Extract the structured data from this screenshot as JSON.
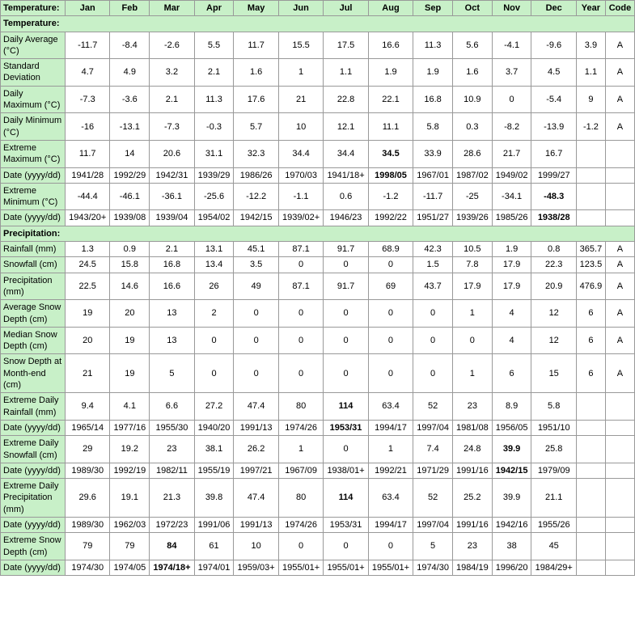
{
  "headers": {
    "label": "Temperature:",
    "cols": [
      "Jan",
      "Feb",
      "Mar",
      "Apr",
      "May",
      "Jun",
      "Jul",
      "Aug",
      "Sep",
      "Oct",
      "Nov",
      "Dec",
      "Year",
      "Code"
    ]
  },
  "sections": [
    {
      "type": "section-header",
      "label": "Temperature:"
    },
    {
      "type": "data-row",
      "label": "Daily Average (°C)",
      "values": [
        "-11.7",
        "-8.4",
        "-2.6",
        "5.5",
        "11.7",
        "15.5",
        "17.5",
        "16.6",
        "11.3",
        "5.6",
        "-4.1",
        "-9.6",
        "3.9",
        "A"
      ]
    },
    {
      "type": "data-row",
      "label": "Standard Deviation",
      "values": [
        "4.7",
        "4.9",
        "3.2",
        "2.1",
        "1.6",
        "1",
        "1.1",
        "1.9",
        "1.9",
        "1.6",
        "3.7",
        "4.5",
        "1.1",
        "A"
      ]
    },
    {
      "type": "data-row",
      "label": "Daily Maximum (°C)",
      "values": [
        "-7.3",
        "-3.6",
        "2.1",
        "11.3",
        "17.6",
        "21",
        "22.8",
        "22.1",
        "16.8",
        "10.9",
        "0",
        "-5.4",
        "9",
        "A"
      ]
    },
    {
      "type": "data-row",
      "label": "Daily Minimum (°C)",
      "values": [
        "-16",
        "-13.1",
        "-7.3",
        "-0.3",
        "5.7",
        "10",
        "12.1",
        "11.1",
        "5.8",
        "0.3",
        "-8.2",
        "-13.9",
        "-1.2",
        "A"
      ]
    },
    {
      "type": "data-row",
      "label": "Extreme Maximum (°C)",
      "values": [
        "11.7",
        "14",
        "20.6",
        "31.1",
        "32.3",
        "34.4",
        "34.4",
        "34.5",
        "33.9",
        "28.6",
        "21.7",
        "16.7",
        "",
        ""
      ],
      "bold_indices": [
        7
      ]
    },
    {
      "type": "data-row",
      "label": "Date (yyyy/dd)",
      "values": [
        "1941/28",
        "1992/29",
        "1942/31",
        "1939/29",
        "1986/26",
        "1970/03",
        "1941/18+",
        "1998/05",
        "1967/01",
        "1987/02",
        "1949/02",
        "1999/27",
        "",
        ""
      ],
      "bold_indices": [
        7
      ]
    },
    {
      "type": "data-row",
      "label": "Extreme Minimum (°C)",
      "values": [
        "-44.4",
        "-46.1",
        "-36.1",
        "-25.6",
        "-12.2",
        "-1.1",
        "0.6",
        "-1.2",
        "-11.7",
        "-25",
        "-34.1",
        "-48.3",
        "",
        ""
      ],
      "bold_indices": [
        11
      ]
    },
    {
      "type": "data-row",
      "label": "Date (yyyy/dd)",
      "values": [
        "1943/20+",
        "1939/08",
        "1939/04",
        "1954/02",
        "1942/15",
        "1939/02+",
        "1946/23",
        "1992/22",
        "1951/27",
        "1939/26",
        "1985/26",
        "1938/28",
        "",
        ""
      ],
      "bold_indices": [
        11
      ]
    },
    {
      "type": "section-header",
      "label": "Precipitation:"
    },
    {
      "type": "data-row",
      "label": "Rainfall (mm)",
      "values": [
        "1.3",
        "0.9",
        "2.1",
        "13.1",
        "45.1",
        "87.1",
        "91.7",
        "68.9",
        "42.3",
        "10.5",
        "1.9",
        "0.8",
        "365.7",
        "A"
      ]
    },
    {
      "type": "data-row",
      "label": "Snowfall (cm)",
      "values": [
        "24.5",
        "15.8",
        "16.8",
        "13.4",
        "3.5",
        "0",
        "0",
        "0",
        "1.5",
        "7.8",
        "17.9",
        "22.3",
        "123.5",
        "A"
      ]
    },
    {
      "type": "data-row",
      "label": "Precipitation (mm)",
      "values": [
        "22.5",
        "14.6",
        "16.6",
        "26",
        "49",
        "87.1",
        "91.7",
        "69",
        "43.7",
        "17.9",
        "17.9",
        "20.9",
        "476.9",
        "A"
      ]
    },
    {
      "type": "data-row",
      "label": "Average Snow Depth (cm)",
      "values": [
        "19",
        "20",
        "13",
        "2",
        "0",
        "0",
        "0",
        "0",
        "0",
        "1",
        "4",
        "12",
        "6",
        "A"
      ]
    },
    {
      "type": "data-row",
      "label": "Median Snow Depth (cm)",
      "values": [
        "20",
        "19",
        "13",
        "0",
        "0",
        "0",
        "0",
        "0",
        "0",
        "0",
        "4",
        "12",
        "6",
        "A"
      ]
    },
    {
      "type": "data-row",
      "label": "Snow Depth at Month-end (cm)",
      "values": [
        "21",
        "19",
        "5",
        "0",
        "0",
        "0",
        "0",
        "0",
        "0",
        "1",
        "6",
        "15",
        "6",
        "A"
      ]
    },
    {
      "type": "data-row",
      "label": "Extreme Daily Rainfall (mm)",
      "values": [
        "9.4",
        "4.1",
        "6.6",
        "27.2",
        "47.4",
        "80",
        "114",
        "63.4",
        "52",
        "23",
        "8.9",
        "5.8",
        "",
        ""
      ],
      "bold_indices": [
        6
      ]
    },
    {
      "type": "data-row",
      "label": "Date (yyyy/dd)",
      "values": [
        "1965/14",
        "1977/16",
        "1955/30",
        "1940/20",
        "1991/13",
        "1974/26",
        "1953/31",
        "1994/17",
        "1997/04",
        "1981/08",
        "1956/05",
        "1951/10",
        "",
        ""
      ],
      "bold_indices": [
        6
      ]
    },
    {
      "type": "data-row",
      "label": "Extreme Daily Snowfall (cm)",
      "values": [
        "29",
        "19.2",
        "23",
        "38.1",
        "26.2",
        "1",
        "0",
        "1",
        "7.4",
        "24.8",
        "39.9",
        "25.8",
        "",
        ""
      ],
      "bold_indices": [
        10
      ]
    },
    {
      "type": "data-row",
      "label": "Date (yyyy/dd)",
      "values": [
        "1989/30",
        "1992/19",
        "1982/11",
        "1955/19",
        "1997/21",
        "1967/09",
        "1938/01+",
        "1992/21",
        "1971/29",
        "1991/16",
        "1942/15",
        "1979/09",
        "",
        ""
      ],
      "bold_indices": [
        10
      ]
    },
    {
      "type": "data-row",
      "label": "Extreme Daily Precipitation (mm)",
      "values": [
        "29.6",
        "19.1",
        "21.3",
        "39.8",
        "47.4",
        "80",
        "114",
        "63.4",
        "52",
        "25.2",
        "39.9",
        "21.1",
        "",
        ""
      ],
      "bold_indices": [
        6
      ]
    },
    {
      "type": "data-row",
      "label": "Date (yyyy/dd)",
      "values": [
        "1989/30",
        "1962/03",
        "1972/23",
        "1991/06",
        "1991/13",
        "1974/26",
        "1953/31",
        "1994/17",
        "1997/04",
        "1991/16",
        "1942/16",
        "1955/26",
        "",
        ""
      ]
    },
    {
      "type": "data-row",
      "label": "Extreme Snow Depth (cm)",
      "values": [
        "79",
        "79",
        "84",
        "61",
        "10",
        "0",
        "0",
        "0",
        "5",
        "23",
        "38",
        "45",
        "",
        ""
      ],
      "bold_indices": [
        2
      ]
    },
    {
      "type": "data-row",
      "label": "Date (yyyy/dd)",
      "values": [
        "1974/30",
        "1974/05",
        "1974/18+",
        "1974/01",
        "1959/03+",
        "1955/01+",
        "1955/01+",
        "1955/01+",
        "1974/30",
        "1984/19",
        "1996/20",
        "1984/29+",
        "",
        ""
      ],
      "bold_indices": [
        2
      ]
    }
  ]
}
